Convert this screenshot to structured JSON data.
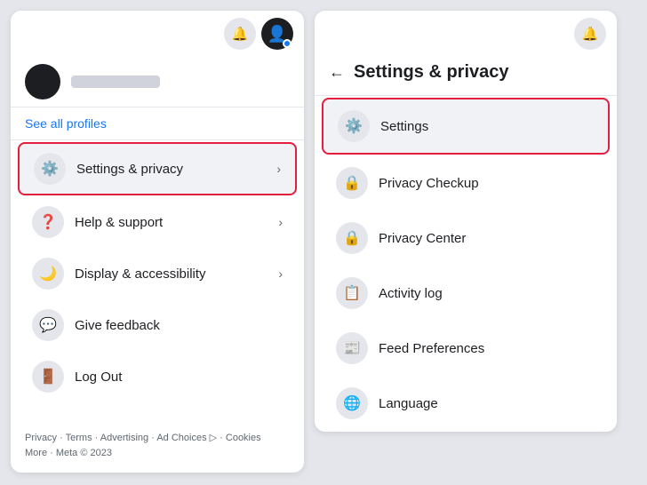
{
  "left_panel": {
    "top_icons": [
      "🔔",
      "👤"
    ],
    "user_name_placeholder": "",
    "see_all_profiles": "See all profiles",
    "menu_items": [
      {
        "id": "settings-privacy",
        "icon": "⚙️",
        "label": "Settings & privacy",
        "has_chevron": true,
        "highlighted": true
      },
      {
        "id": "help-support",
        "icon": "❓",
        "label": "Help & support",
        "has_chevron": true,
        "highlighted": false
      },
      {
        "id": "display-accessibility",
        "icon": "🌙",
        "label": "Display & accessibility",
        "has_chevron": true,
        "highlighted": false
      },
      {
        "id": "give-feedback",
        "icon": "💬",
        "label": "Give feedback",
        "has_chevron": false,
        "highlighted": false
      },
      {
        "id": "log-out",
        "icon": "🚪",
        "label": "Log Out",
        "has_chevron": false,
        "highlighted": false
      }
    ],
    "footer_links": [
      "Privacy",
      "Terms",
      "Advertising",
      "Ad Choices",
      "Cookies"
    ],
    "footer_meta": "Meta © 2023"
  },
  "right_panel": {
    "title": "Settings & privacy",
    "top_icon": "🔔",
    "back_arrow": "←",
    "menu_items": [
      {
        "id": "settings",
        "icon": "⚙️",
        "label": "Settings",
        "active": true
      },
      {
        "id": "privacy-checkup",
        "icon": "🔒",
        "label": "Privacy Checkup",
        "active": false
      },
      {
        "id": "privacy-center",
        "icon": "🔒",
        "label": "Privacy Center",
        "active": false
      },
      {
        "id": "activity-log",
        "icon": "📋",
        "label": "Activity log",
        "active": false
      },
      {
        "id": "feed-preferences",
        "icon": "📰",
        "label": "Feed Preferences",
        "active": false
      },
      {
        "id": "language",
        "icon": "🌐",
        "label": "Language",
        "active": false
      }
    ]
  }
}
